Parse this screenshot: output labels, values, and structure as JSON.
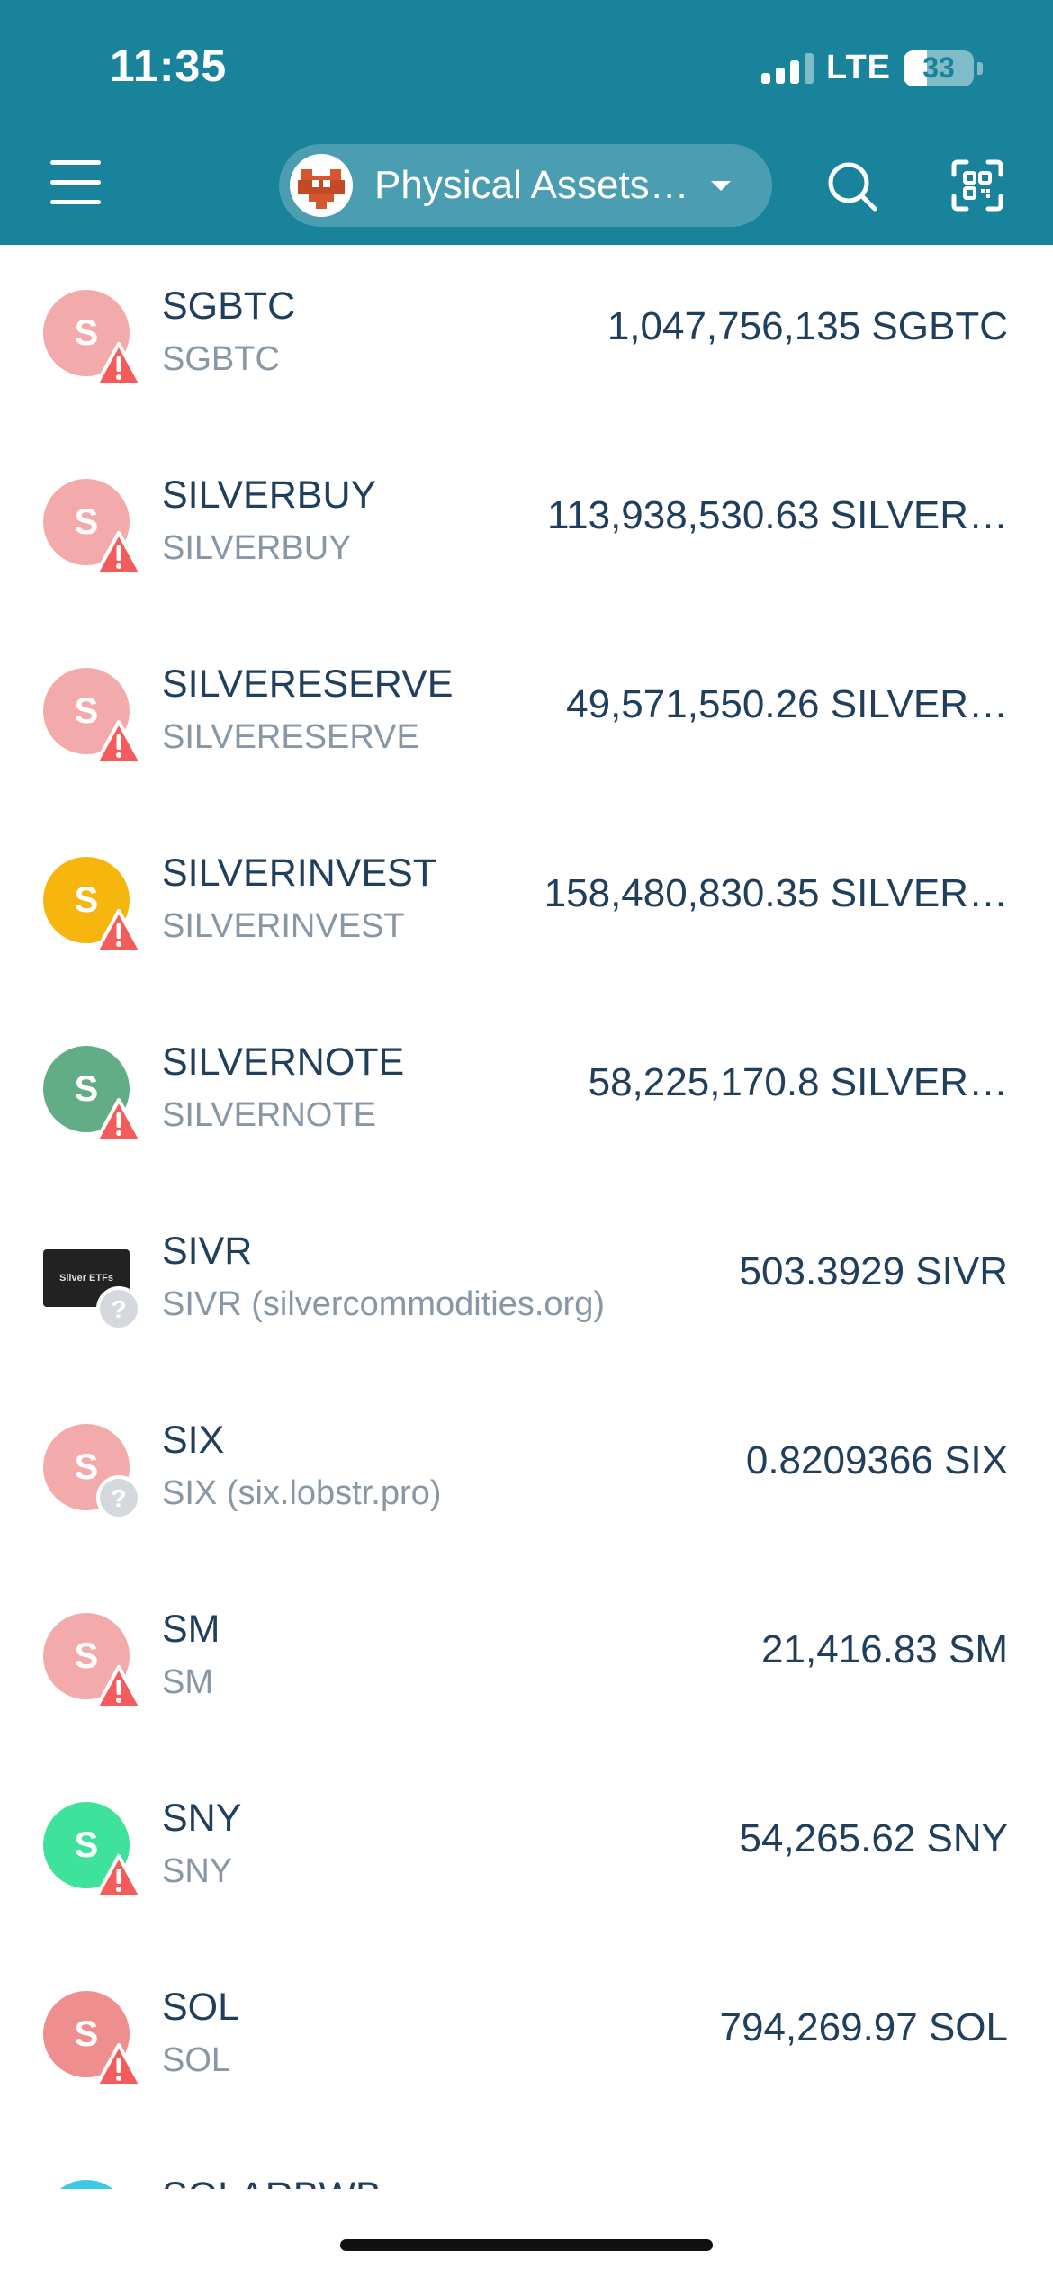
{
  "status_bar": {
    "time": "11:35",
    "network": "LTE",
    "battery": "33",
    "battery_level": 0.33
  },
  "header": {
    "menu_icon": "hamburger-menu-icon",
    "account_name": "Physical Assets…",
    "search_icon": "search-icon",
    "scan_icon": "qr-scan-icon"
  },
  "assets": [
    {
      "name": "SGBTC",
      "subtitle": "SGBTC",
      "balance": "1,047,756,135 SGBTC",
      "letter": "S",
      "color": "#F3AAAA",
      "badge": "warning"
    },
    {
      "name": "SILVERBUY",
      "subtitle": "SILVERBUY",
      "balance": "113,938,530.63 SILVER…",
      "letter": "S",
      "color": "#F3AAAA",
      "badge": "warning"
    },
    {
      "name": "SILVERESERVE",
      "subtitle": "SILVERESERVE",
      "balance": "49,571,550.26 SILVER…",
      "letter": "S",
      "color": "#F3AAAA",
      "badge": "warning"
    },
    {
      "name": "SILVERINVEST",
      "subtitle": "SILVERINVEST",
      "balance": "158,480,830.35 SILVER…",
      "letter": "S",
      "color": "#F6B60E",
      "badge": "warning"
    },
    {
      "name": "SILVERNOTE",
      "subtitle": "SILVERNOTE",
      "balance": "58,225,170.8 SILVER…",
      "letter": "S",
      "color": "#63AD86",
      "badge": "warning"
    },
    {
      "name": "SIVR",
      "subtitle": "SIVR (silvercommodities.org)",
      "balance": "503.3929 SIVR",
      "letter": "",
      "color": "#222222",
      "badge": "unknown",
      "thumb_text": "Silver ETFs"
    },
    {
      "name": "SIX",
      "subtitle": "SIX (six.lobstr.pro)",
      "balance": "0.8209366 SIX",
      "letter": "S",
      "color": "#F3AAAA",
      "badge": "unknown"
    },
    {
      "name": "SM",
      "subtitle": "SM",
      "balance": "21,416.83 SM",
      "letter": "S",
      "color": "#F3AAAA",
      "badge": "warning"
    },
    {
      "name": "SNY",
      "subtitle": "SNY",
      "balance": "54,265.62 SNY",
      "letter": "S",
      "color": "#3EE29A",
      "badge": "warning"
    },
    {
      "name": "SOL",
      "subtitle": "SOL",
      "balance": "794,269.97 SOL",
      "letter": "S",
      "color": "#EE8E8E",
      "badge": "warning"
    },
    {
      "name": "SOLARBWB",
      "subtitle": "",
      "balance": "",
      "letter": "S",
      "color": "#3CC9E6",
      "badge": "none"
    }
  ]
}
